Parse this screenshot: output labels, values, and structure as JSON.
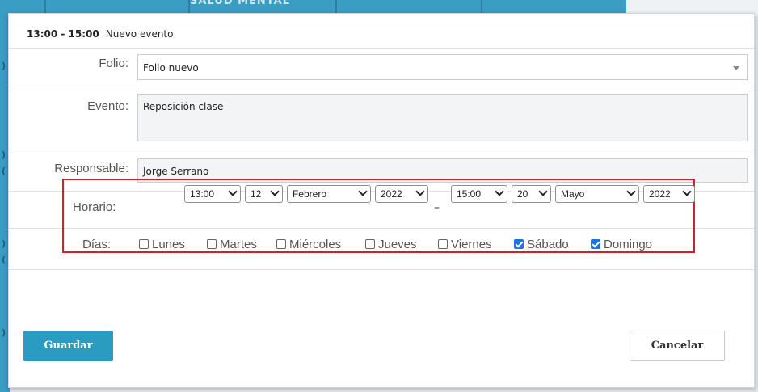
{
  "background": {
    "header_text": "SALUD MENTAL"
  },
  "dialog": {
    "time_range": "13:00 - 15:00",
    "title": "Nuevo evento",
    "folio": {
      "label": "Folio:",
      "value": "Folio nuevo"
    },
    "evento": {
      "label": "Evento:",
      "value": "Reposición clase"
    },
    "responsable": {
      "label": "Responsable:",
      "value": "Jorge Serrano"
    },
    "horario": {
      "label": "Horario:",
      "start_time": "13:00",
      "start_day": "12",
      "start_month": "Febrero",
      "start_year": "2022",
      "separator": "–",
      "end_time": "15:00",
      "end_day": "20",
      "end_month": "Mayo",
      "end_year": "2022"
    },
    "dias": {
      "label": "Días:",
      "items": [
        {
          "label": "Lunes",
          "checked": false
        },
        {
          "label": "Martes",
          "checked": false
        },
        {
          "label": "Miércoles",
          "checked": false
        },
        {
          "label": "Jueves",
          "checked": false
        },
        {
          "label": "Viernes",
          "checked": false
        },
        {
          "label": "Sábado",
          "checked": true
        },
        {
          "label": "Domingo",
          "checked": true
        }
      ]
    },
    "save_label": "Guardar",
    "cancel_label": "Cancelar"
  },
  "colors": {
    "accent": "#2a9cc2",
    "highlight_border": "#d0202a",
    "checkbox_checked": "#1a73e8"
  }
}
